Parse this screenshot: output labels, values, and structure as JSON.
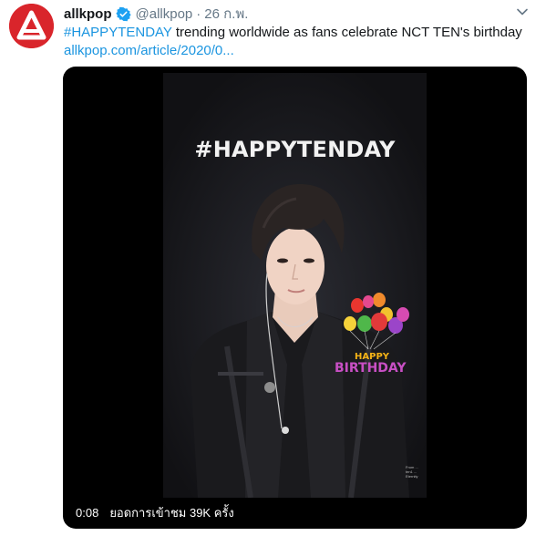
{
  "author": {
    "name": "allkpop",
    "handle": "@allkpop",
    "separator": "·",
    "date": "26 ก.พ.",
    "verified": true,
    "avatar_color": "#d9252b"
  },
  "tweet": {
    "hashtag": "#HAPPYTENDAY",
    "text": " trending worldwide as fans celebrate NCT TEN's birthday",
    "link": "allkpop.com/article/2020/0..."
  },
  "video": {
    "overlay_title": "#HAPPYTENDAY",
    "birthday_line1": "HAPPY",
    "birthday_line2": "BIRTHDAY",
    "credit": "From ... ten1 ... Eternity",
    "elapsed": "0:08",
    "views_text": "ยอดการเข้าชม 39K ครั้ง"
  },
  "colors": {
    "link": "#1b95e0",
    "secondary_text": "#657786",
    "media_bg": "#000000"
  },
  "icons": {
    "verified": "verified-badge-icon",
    "menu": "chevron-down-icon",
    "avatar": "allkpop-logo-icon"
  }
}
